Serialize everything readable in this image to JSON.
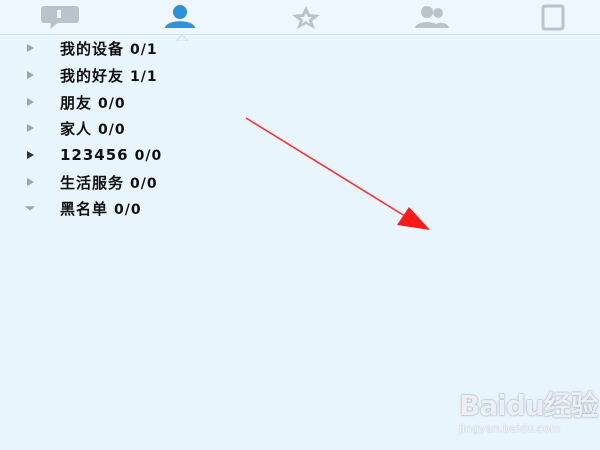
{
  "tabs": [
    {
      "icon": "chat-icon",
      "active": false
    },
    {
      "icon": "contacts-icon",
      "active": true
    },
    {
      "icon": "star-icon",
      "active": false
    },
    {
      "icon": "group-icon",
      "active": false
    },
    {
      "icon": "tablet-icon",
      "active": false
    }
  ],
  "groups": [
    {
      "name": "我的设备",
      "count": "0/1",
      "expanded": false
    },
    {
      "name": "我的好友",
      "count": "1/1",
      "expanded": false
    },
    {
      "name": "朋友",
      "count": "0/0",
      "expanded": false
    },
    {
      "name": "家人",
      "count": "0/0",
      "expanded": false
    },
    {
      "name": "123456",
      "count": "0/0",
      "expanded": false
    },
    {
      "name": "生活服务",
      "count": "0/0",
      "expanded": false
    },
    {
      "name": "黑名单",
      "count": "0/0",
      "expanded": true
    }
  ],
  "watermark": {
    "logo": "Baidu经验",
    "url": "jingyan.baidu.com"
  },
  "colors": {
    "background": "#e9f5fd",
    "active_tab": "#2f8fd8",
    "inactive_tab": "#b9c3cb",
    "annotation_arrow": "#ff3030"
  }
}
